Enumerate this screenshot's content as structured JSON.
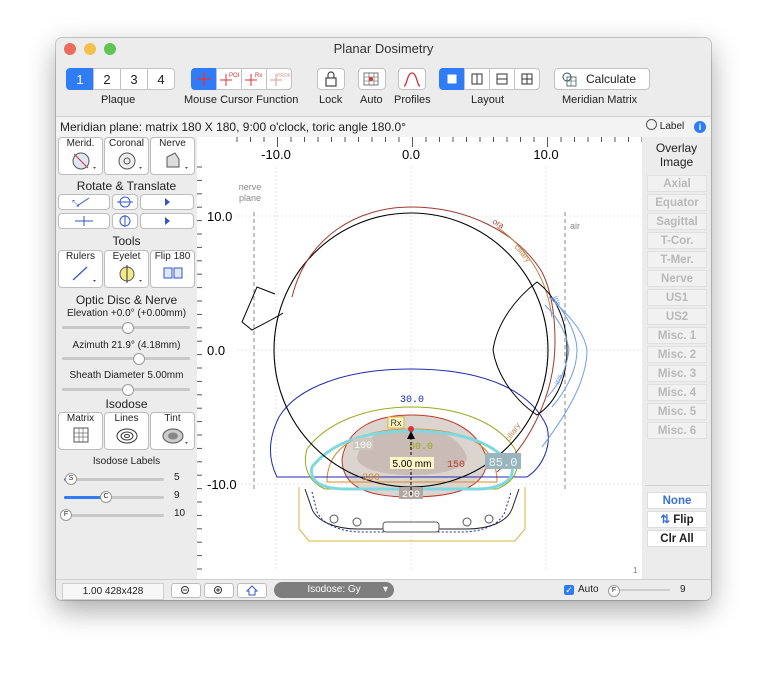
{
  "window": {
    "title": "Planar Dosimetry"
  },
  "toolbar": {
    "plaque": {
      "label": "Plaque",
      "options": [
        "1",
        "2",
        "3",
        "4"
      ],
      "selected": "1"
    },
    "mouse_cursor": {
      "label": "Mouse Cursor Function",
      "options": [
        "POI",
        "Rx",
        "PROF"
      ]
    },
    "lock": {
      "label": "Lock"
    },
    "auto": {
      "label": "Auto"
    },
    "profiles": {
      "label": "Profiles"
    },
    "layout": {
      "label": "Layout"
    },
    "calculate": {
      "button": "Calculate",
      "label": "Meridian Matrix"
    }
  },
  "infobar": {
    "text": "Meridian plane: matrix 180 X 180, 9:00 o'clock, toric angle 180.0°",
    "label_toggle": "Label"
  },
  "left": {
    "view_buttons": [
      "Merid.",
      "Coronal",
      "Nerve"
    ],
    "rotate_title": "Rotate & Translate",
    "tools_title": "Tools",
    "tools_buttons": [
      "Rulers",
      "Eyelet",
      "Flip 180"
    ],
    "optic_title": "Optic Disc & Nerve",
    "elevation": "Elevation +0.0° (+0.00mm)",
    "azimuth": "Azimuth 21.9° (4.18mm)",
    "sheath": "Sheath Diameter 5.00mm",
    "isodose_title": "Isodose",
    "isodose_buttons": [
      "Matrix",
      "Lines",
      "Tint"
    ],
    "isodose_labels_title": "Isodose Labels",
    "sliders": [
      {
        "letter": "S",
        "value": "5",
        "level": 0.05
      },
      {
        "letter": "C",
        "value": "9",
        "level": 0.4
      },
      {
        "letter": "F",
        "value": "10",
        "level": 0.0
      }
    ]
  },
  "right": {
    "title": "Overlay Image",
    "overlays": [
      "Axial",
      "Equator",
      "Sagittal",
      "T-Cor.",
      "T-Mer.",
      "Nerve",
      "US1",
      "US2",
      "Misc. 1",
      "Misc. 2",
      "Misc. 3",
      "Misc. 4",
      "Misc. 5",
      "Misc. 6"
    ],
    "none": "None",
    "flip": "Flip",
    "clr_all": "Clr All"
  },
  "plot": {
    "x_ticks": [
      "-10.0",
      "0.0",
      "10.0"
    ],
    "y_ticks": [
      "10.0",
      "0.0",
      "-10.0"
    ],
    "annotations": {
      "nerve_plane": "nerve\nplane",
      "air": "air",
      "ora": "ora",
      "ciliary": "ciliary",
      "iris": "iris",
      "iris2": "iris",
      "ciliary2": "ciliary",
      "rx": "Rx",
      "measure": "5.00 mm",
      "corner": "1"
    },
    "isodose_labels": [
      "30.0",
      "60.0",
      "100",
      "150",
      "200",
      "85.0",
      "200"
    ],
    "colors": {
      "sclera": "#000000",
      "ora": "#a0392f",
      "iris": "#6f9fe0",
      "iso30": "#1f2bb0",
      "iso60": "#9aaa1c",
      "iso85": "#7fd8e0",
      "iso150": "#c0392b",
      "iso200": "#d98b2b"
    }
  },
  "bottom": {
    "zoom": "1.00 428x428",
    "isodose_popup": "Isodose: Gy",
    "auto_label": "Auto",
    "auto_checked": true,
    "slider_letter": "F",
    "slider_value": "9"
  }
}
